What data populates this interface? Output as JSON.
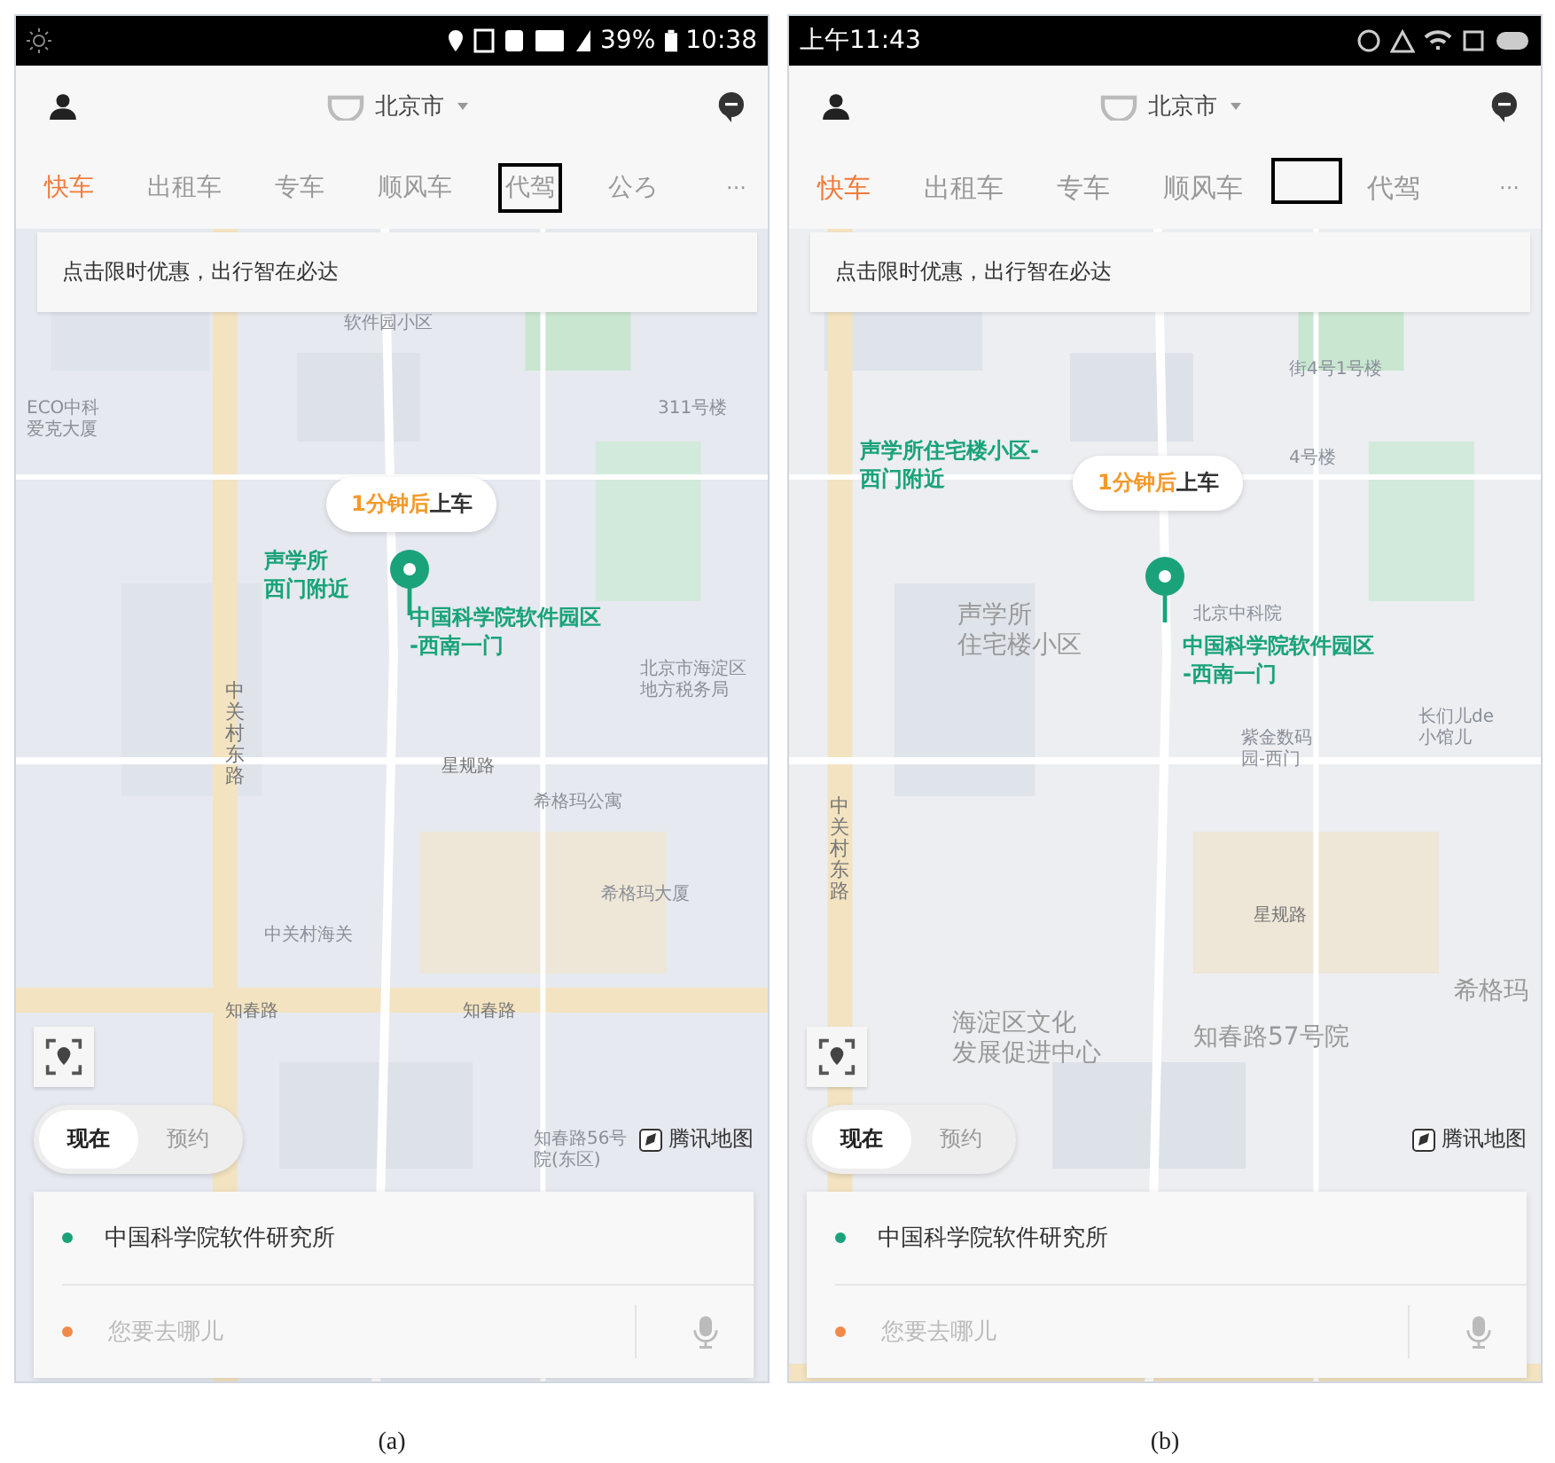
{
  "panels": [
    {
      "caption": "(a)",
      "status_bar": {
        "battery": "39%",
        "time": "10:38"
      },
      "header": {
        "city": "北京市"
      },
      "tabs": [
        {
          "label": "快车",
          "selected": true,
          "boxed": false
        },
        {
          "label": "出租车",
          "selected": false,
          "boxed": false
        },
        {
          "label": "专车",
          "selected": false,
          "boxed": false
        },
        {
          "label": "顺风车",
          "selected": false,
          "boxed": false
        },
        {
          "label": "代驾",
          "selected": false,
          "boxed": true
        },
        {
          "label": "公ろ",
          "selected": false,
          "boxed": false
        }
      ],
      "more": "···",
      "banner": "点击限时优惠，出行智在必达",
      "map_labels": [
        {
          "kind": "place",
          "lines": [
            "软件园小区"
          ]
        },
        {
          "kind": "place",
          "lines": [
            "ECO中科",
            "爱克大厦"
          ]
        },
        {
          "kind": "place",
          "lines": [
            "311号楼"
          ]
        },
        {
          "kind": "vertical",
          "lines": [
            "中关村东路"
          ]
        },
        {
          "kind": "place",
          "lines": [
            "北京市海淀区",
            "地方税务局"
          ]
        },
        {
          "kind": "street",
          "lines": [
            "星规路"
          ]
        },
        {
          "kind": "place",
          "lines": [
            "希格玛公寓"
          ]
        },
        {
          "kind": "place",
          "lines": [
            "希格玛大厦"
          ]
        },
        {
          "kind": "place",
          "lines": [
            "中关村海关"
          ]
        },
        {
          "kind": "street",
          "lines": [
            "知春路"
          ]
        },
        {
          "kind": "street",
          "lines": [
            "知春路"
          ]
        },
        {
          "kind": "place",
          "lines": [
            "知春路56号",
            "院(东区)"
          ]
        }
      ],
      "nearby_point": {
        "lines": [
          "声学所",
          "西门附近"
        ]
      },
      "pickup_point": {
        "lines": [
          "中国科学院软件园区",
          "-西南一门"
        ]
      },
      "bubble": {
        "eta": "1分钟后",
        "action": "上车"
      },
      "time_toggle": [
        {
          "label": "现在",
          "selected": true
        },
        {
          "label": "预约",
          "selected": false
        }
      ],
      "map_credit": "腾讯地图",
      "trip_card": [
        {
          "kind": "origin",
          "text": "中国科学院软件研究所",
          "color": "#1aa37a"
        },
        {
          "kind": "destination",
          "placeholder": "您要去哪儿",
          "color": "#f08a4b"
        }
      ]
    },
    {
      "caption": "(b)",
      "status_bar": {
        "time": "上午11:43"
      },
      "header": {
        "city": "北京市"
      },
      "tabs": [
        {
          "label": "快车",
          "selected": true,
          "boxed": false
        },
        {
          "label": "出租车",
          "selected": false,
          "boxed": false
        },
        {
          "label": "专车",
          "selected": false,
          "boxed": false
        },
        {
          "label": "顺风车",
          "selected": false,
          "boxed": false
        },
        {
          "label": "代驾",
          "selected": false,
          "boxed": false
        }
      ],
      "more": "···",
      "marker": true,
      "banner": "点击限时优惠，出行智在必达",
      "map_labels": [
        {
          "kind": "place",
          "lines": [
            "街4号1号楼"
          ]
        },
        {
          "kind": "place",
          "lines": [
            "4号楼"
          ]
        },
        {
          "kind": "big",
          "lines": [
            "声学所",
            "住宅楼小区"
          ]
        },
        {
          "kind": "place",
          "lines": [
            "北京中科院"
          ]
        },
        {
          "kind": "place",
          "lines": [
            "紫金数码",
            "园-西门"
          ]
        },
        {
          "kind": "place",
          "lines": [
            "长们儿de",
            "小馆儿"
          ]
        },
        {
          "kind": "vertical",
          "lines": [
            "中关村东路"
          ]
        },
        {
          "kind": "street",
          "lines": [
            "星规路"
          ]
        },
        {
          "kind": "big",
          "lines": [
            "希格玛"
          ]
        },
        {
          "kind": "big",
          "lines": [
            "海淀区文化",
            "发展促进中心"
          ]
        },
        {
          "kind": "big",
          "lines": [
            "知春路57号院"
          ]
        }
      ],
      "nearby_point": {
        "lines": [
          "声学所住宅楼小区-",
          "西门附近"
        ]
      },
      "pickup_point": {
        "lines": [
          "中国科学院软件园区",
          "-西南一门"
        ]
      },
      "bubble": {
        "eta": "1分钟后",
        "action": "上车"
      },
      "time_toggle": [
        {
          "label": "现在",
          "selected": true
        },
        {
          "label": "预约",
          "selected": false
        }
      ],
      "map_credit": "腾讯地图",
      "trip_card": [
        {
          "kind": "origin",
          "text": "中国科学院软件研究所",
          "color": "#1aa37a"
        },
        {
          "kind": "destination",
          "placeholder": "您要去哪儿",
          "color": "#f08a4b"
        }
      ]
    }
  ]
}
